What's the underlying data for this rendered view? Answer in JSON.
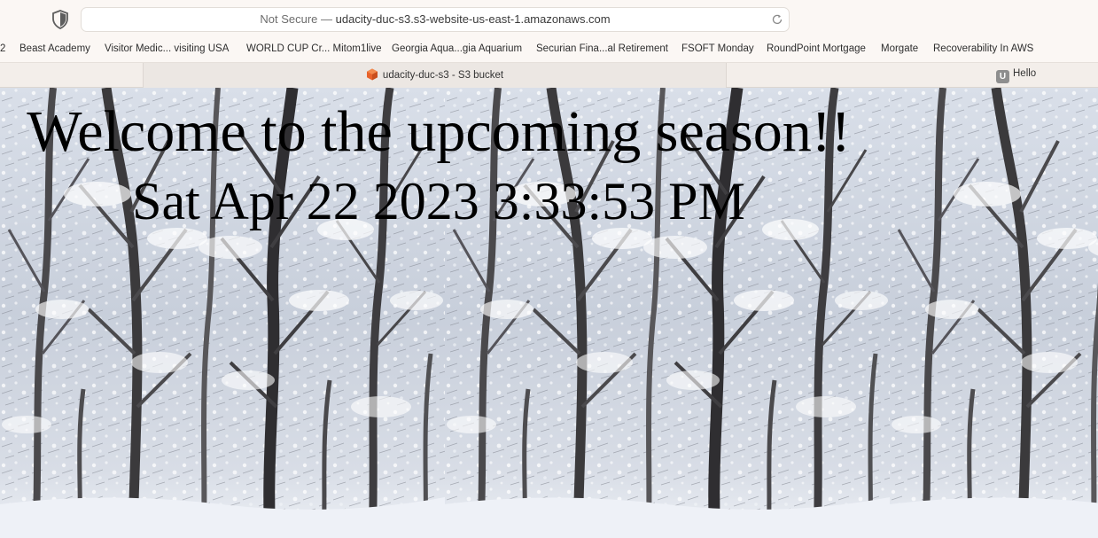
{
  "toolbar": {
    "security_label": "Not Secure —",
    "url": "udacity-duc-s3.s3-website-us-east-1.amazonaws.com"
  },
  "bookmarks": [
    "2",
    "Beast Academy",
    "Visitor Medic... visiting USA",
    "WORLD CUP Cr... Mitom1live",
    "Georgia Aqua...gia Aquarium",
    "Securian Fina...al Retirement",
    "FSOFT Monday",
    "RoundPoint Mortgage",
    "Morgate",
    "Recoverability In AWS"
  ],
  "tabs": {
    "active_title": "udacity-duc-s3 - S3 bucket",
    "right_title": "Hello",
    "right_icon_letter": "U"
  },
  "page": {
    "headline": "Welcome to the upcoming season!!",
    "datetime": "Sat Apr 22 2023 3:33:53 PM"
  },
  "colors": {
    "s3_icon": "#e8622a",
    "chrome_bg": "#fbf7f4",
    "tab_active_bg": "#ece7e3"
  }
}
